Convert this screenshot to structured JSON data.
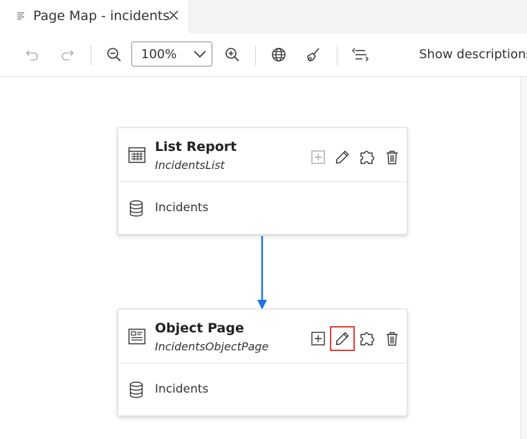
{
  "tab": {
    "title": "Page Map - incidents"
  },
  "toolbar": {
    "zoom_value": "100%",
    "show_descriptions_label": "Show descriptions"
  },
  "pages": [
    {
      "title": "List Report",
      "subtitle": "IncidentsList",
      "entity": "Incidents",
      "add_enabled": false
    },
    {
      "title": "Object Page",
      "subtitle": "IncidentsObjectPage",
      "entity": "Incidents",
      "add_enabled": true
    }
  ],
  "colors": {
    "connector": "#1a73e8",
    "highlight": "#e53935",
    "icon": "#333333",
    "disabled_icon": "#a8a8a8"
  }
}
